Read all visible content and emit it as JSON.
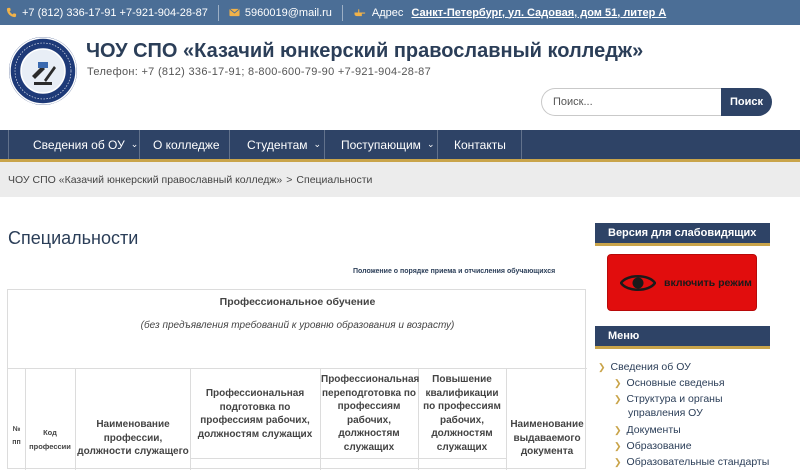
{
  "topbar": {
    "phones": "+7 (812) 336-17-91 +7-921-904-28-87",
    "email": "5960019@mail.ru",
    "address_label": "Адрес",
    "address": "Санкт-Петербург, ул. Садовая, дом 51, литер А"
  },
  "header": {
    "title": "ЧОУ СПО «Казачий юнкерский православный колледж»",
    "phone": "Телефон: +7 (812) 336-17-91; 8-800-600-79-90 +7-921-904-28-87"
  },
  "search": {
    "placeholder": "Поиск...",
    "button": "Поиск"
  },
  "nav": {
    "items": [
      {
        "label": "Сведения об ОУ",
        "has_dropdown": true
      },
      {
        "label": "О колледже",
        "has_dropdown": false
      },
      {
        "label": "Студентам",
        "has_dropdown": true
      },
      {
        "label": "Поступающим",
        "has_dropdown": true
      },
      {
        "label": "Контакты",
        "has_dropdown": false
      }
    ]
  },
  "breadcrumb": {
    "home": "ЧОУ СПО «Казачий юнкерский православный колледж»",
    "separator": ">",
    "current": "Специальности"
  },
  "content": {
    "page_title": "Специальности",
    "doc_link": "Положение о порядке приема и отчисления обучающихся",
    "table": {
      "title": "Профессиональное обучение",
      "subtitle": "(без предъявления требований к уровню образования и возрасту)",
      "headers": {
        "num": "№ пп",
        "code": "Код профессии",
        "name": "Наименование профессии, должности служащего",
        "prep": "Профессиональная подготовка по профессиям рабочих, должностям служащих",
        "retrain": "Профессиональная переподготовка по профессиям рабочих, должностям служащих",
        "qual": "Повышение квалификации по профессиям рабочих, должностям служащих",
        "doc": "Наименование выдаваемого документа"
      }
    }
  },
  "sidebar": {
    "accessibility_heading": "Версия для слабовидящих",
    "accessibility_button": "включить режим",
    "menu_heading": "Меню",
    "menu_items": [
      {
        "label": "Сведения об ОУ",
        "level": 1
      },
      {
        "label": "Основные сведенья",
        "level": 2
      },
      {
        "label": "Структура и органы управления ОУ",
        "level": 2
      },
      {
        "label": "Документы",
        "level": 2
      },
      {
        "label": "Образование",
        "level": 2
      },
      {
        "label": "Образовательные стандарты",
        "level": 2
      }
    ]
  },
  "colors": {
    "topbar": "#4b6e96",
    "nav": "#2e4366",
    "accent_gold": "#c9a44a",
    "accessibility_button": "#e10d0d"
  },
  "icons": [
    "phone-icon",
    "mail-icon",
    "hand-pointer-icon",
    "chevron-down-icon",
    "eye-icon",
    "chevron-right-icon"
  ]
}
